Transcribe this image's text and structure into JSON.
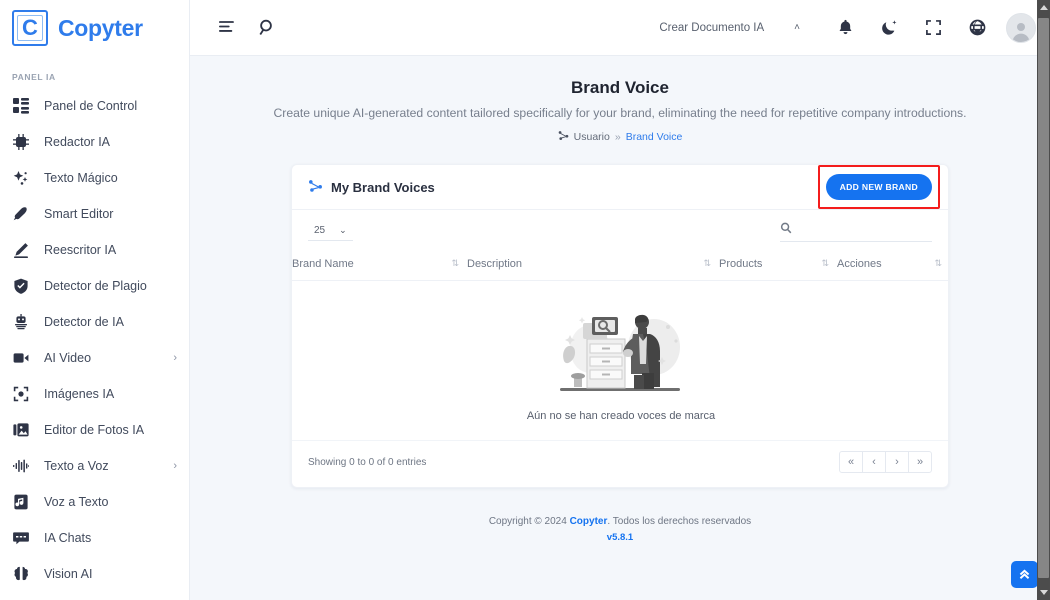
{
  "brand": {
    "logo_letter": "C",
    "name": "Copyter"
  },
  "sidebar": {
    "section_label": "PANEL IA",
    "items": [
      {
        "label": "Panel de Control",
        "icon": "dashboard-icon",
        "caret": ""
      },
      {
        "label": "Redactor IA",
        "icon": "ai-chip-icon",
        "caret": ""
      },
      {
        "label": "Texto Mágico",
        "icon": "sparkles-icon",
        "caret": ""
      },
      {
        "label": "Smart Editor",
        "icon": "pen-icon",
        "caret": ""
      },
      {
        "label": "Reescritor IA",
        "icon": "pencil-icon",
        "caret": ""
      },
      {
        "label": "Detector de Plagio",
        "icon": "shield-icon",
        "caret": ""
      },
      {
        "label": "Detector de IA",
        "icon": "robot-icon",
        "caret": ""
      },
      {
        "label": "AI Video",
        "icon": "video-icon",
        "caret": "›"
      },
      {
        "label": "Imágenes IA",
        "icon": "image-frame-icon",
        "caret": ""
      },
      {
        "label": "Editor de Fotos IA",
        "icon": "photo-editor-icon",
        "caret": ""
      },
      {
        "label": "Texto a Voz",
        "icon": "waveform-icon",
        "caret": "›"
      },
      {
        "label": "Voz a Texto",
        "icon": "audio-file-icon",
        "caret": ""
      },
      {
        "label": "IA Chats",
        "icon": "chat-icon",
        "caret": ""
      },
      {
        "label": "Vision AI",
        "icon": "brain-icon",
        "caret": ""
      }
    ]
  },
  "topbar": {
    "menu_icon": "hamburger-align-icon",
    "search_icon": "search-icon",
    "create_doc_label": "Crear Documento IA",
    "create_doc_caret": "˄",
    "notification_icon": "bell-icon",
    "theme_icon": "moon-icon",
    "fullscreen_icon": "fullscreen-icon",
    "language_icon": "globe-icon",
    "avatar_icon": "user-avatar"
  },
  "page": {
    "title": "Brand Voice",
    "subtitle": "Create unique AI-generated content tailored specifically for your brand, eliminating the need for repetitive company introductions.",
    "breadcrumb": {
      "icon": "user-node-icon",
      "root": "Usuario",
      "separator": "»",
      "current": "Brand Voice"
    }
  },
  "card": {
    "title": "My Brand Voices",
    "title_icon": "brand-voice-icon",
    "add_button": "ADD NEW BRAND",
    "highlight_color": "#f41c1c",
    "accent_color": "#1573f0",
    "length_value": "25",
    "length_caret": "⌄",
    "search_placeholder": "",
    "search_value": "",
    "search_icon": "search-icon",
    "columns": [
      {
        "label": "Brand Name",
        "sort_icon": "sort-icon"
      },
      {
        "label": "Description",
        "sort_icon": "sort-icon"
      },
      {
        "label": "Products",
        "sort_icon": "sort-icon"
      },
      {
        "label": "Acciones",
        "sort_icon": "sort-icon"
      }
    ],
    "rows": [],
    "empty_message": "Aún no se han creado voces de marca",
    "empty_illustration": "person-searching-files-illustration",
    "showing_text": "Showing 0 to 0 of 0 entries",
    "pagination": [
      {
        "label": "«",
        "name": "pager-first"
      },
      {
        "label": "‹",
        "name": "pager-prev"
      },
      {
        "label": "›",
        "name": "pager-next"
      },
      {
        "label": "»",
        "name": "pager-last"
      }
    ]
  },
  "footer": {
    "copyright_pre": "Copyright © 2024 ",
    "copyright_brand": "Copyter",
    "copyright_post": ". Todos los derechos reservados",
    "version": "v5.8.1"
  },
  "scroll_top_button": {
    "icon": "double-chevron-up-icon"
  }
}
